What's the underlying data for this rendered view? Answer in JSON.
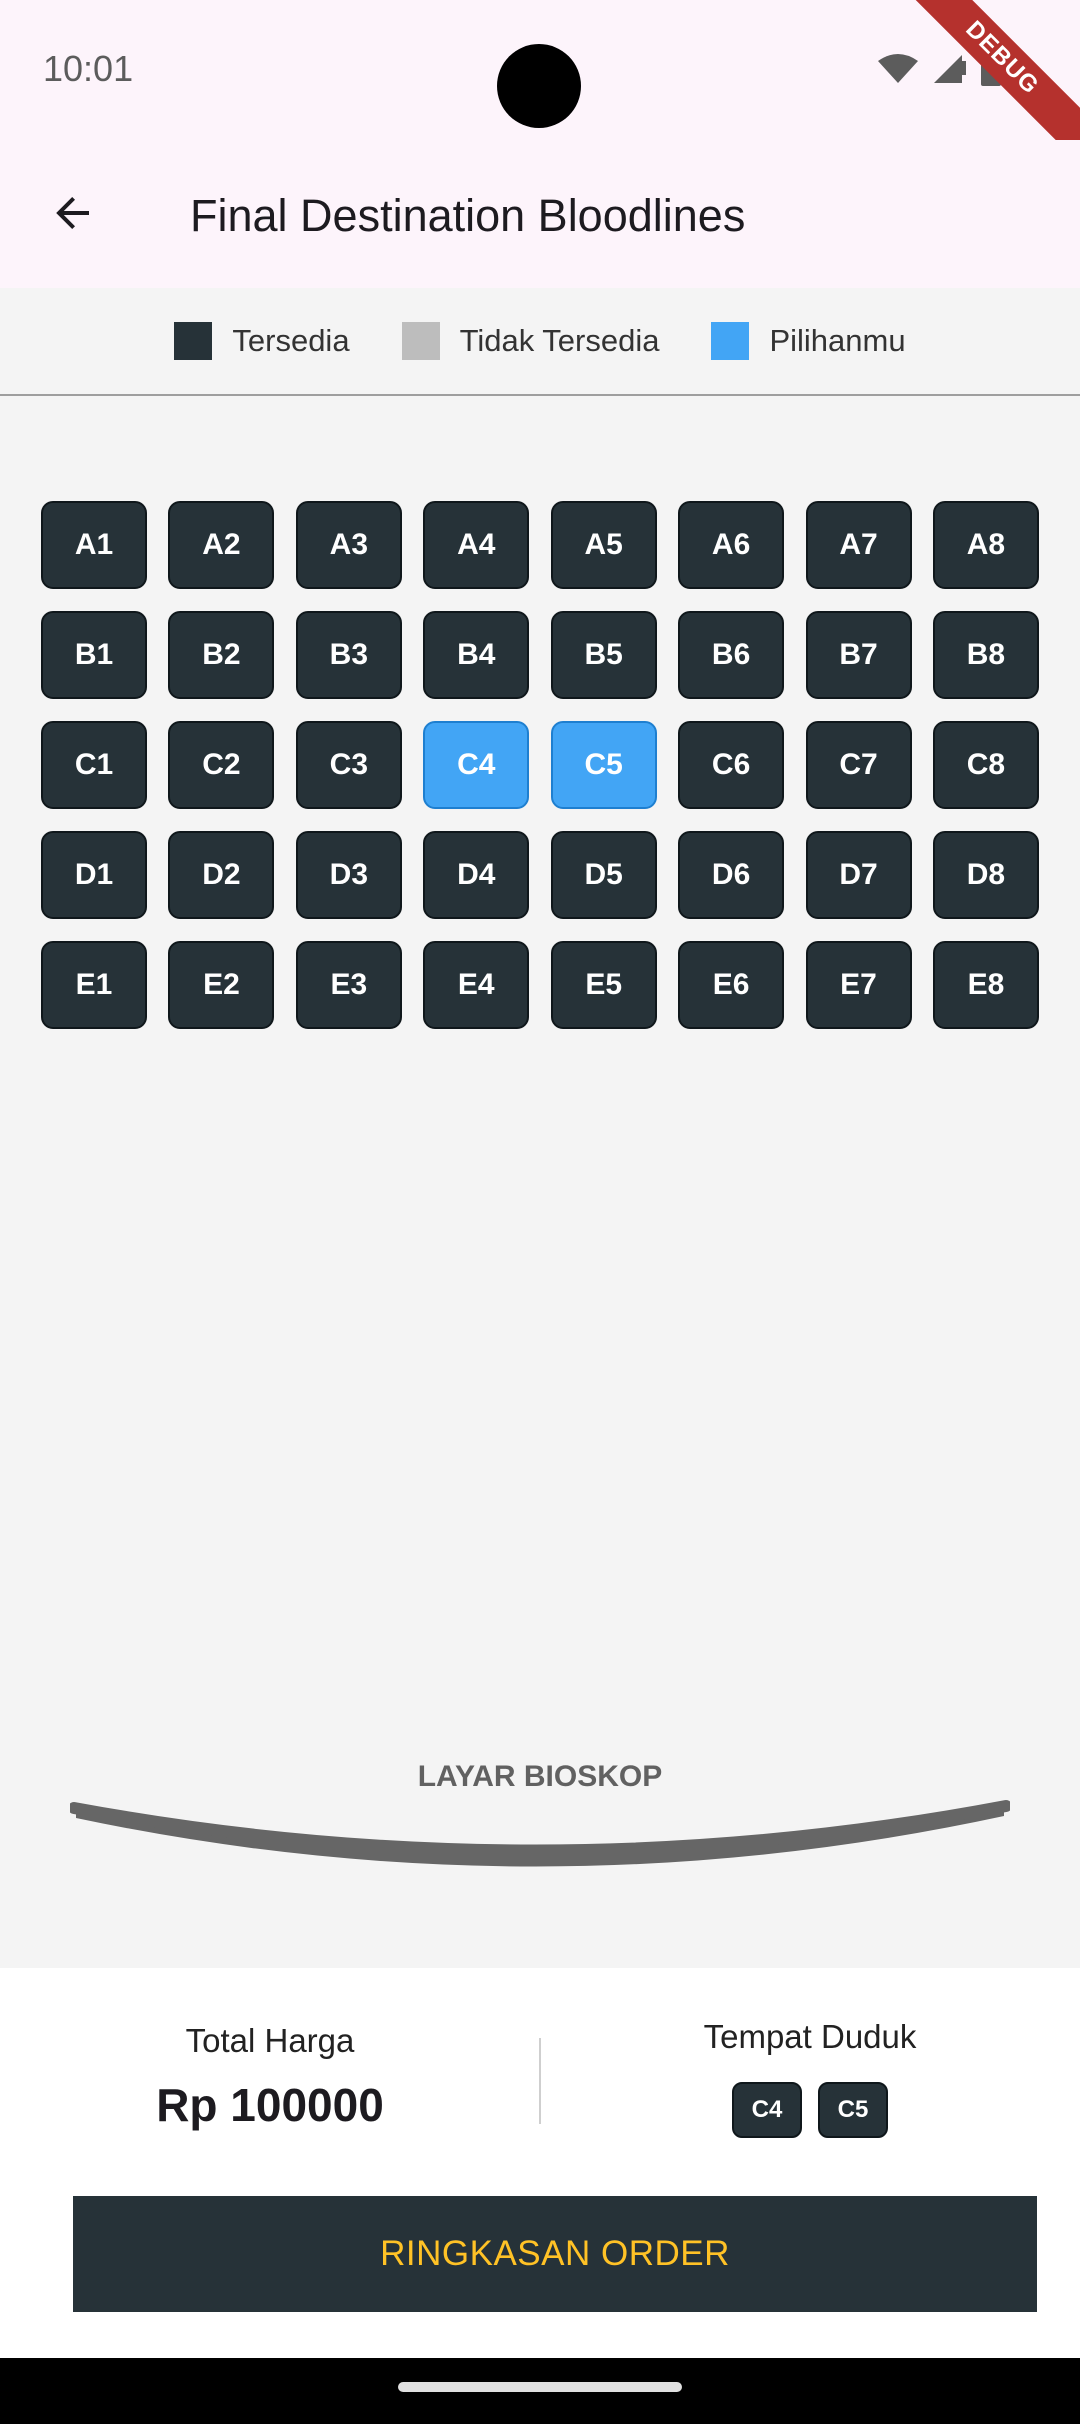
{
  "status_bar": {
    "time": "10:01",
    "debug_label": "DEBUG"
  },
  "app_bar": {
    "title": "Final Destination Bloodlines"
  },
  "legend": [
    {
      "label": "Tersedia",
      "color": "#263238"
    },
    {
      "label": "Tidak Tersedia",
      "color": "#bdbdbd"
    },
    {
      "label": "Pilihanmu",
      "color": "#42a5f5"
    }
  ],
  "seat_rows": [
    {
      "row": "A",
      "seats": [
        {
          "label": "A1",
          "state": "available"
        },
        {
          "label": "A2",
          "state": "available"
        },
        {
          "label": "A3",
          "state": "available"
        },
        {
          "label": "A4",
          "state": "available"
        },
        {
          "label": "A5",
          "state": "available"
        },
        {
          "label": "A6",
          "state": "available"
        },
        {
          "label": "A7",
          "state": "available"
        },
        {
          "label": "A8",
          "state": "available"
        }
      ]
    },
    {
      "row": "B",
      "seats": [
        {
          "label": "B1",
          "state": "available"
        },
        {
          "label": "B2",
          "state": "available"
        },
        {
          "label": "B3",
          "state": "available"
        },
        {
          "label": "B4",
          "state": "available"
        },
        {
          "label": "B5",
          "state": "available"
        },
        {
          "label": "B6",
          "state": "available"
        },
        {
          "label": "B7",
          "state": "available"
        },
        {
          "label": "B8",
          "state": "available"
        }
      ]
    },
    {
      "row": "C",
      "seats": [
        {
          "label": "C1",
          "state": "available"
        },
        {
          "label": "C2",
          "state": "available"
        },
        {
          "label": "C3",
          "state": "available"
        },
        {
          "label": "C4",
          "state": "selected"
        },
        {
          "label": "C5",
          "state": "selected"
        },
        {
          "label": "C6",
          "state": "available"
        },
        {
          "label": "C7",
          "state": "available"
        },
        {
          "label": "C8",
          "state": "available"
        }
      ]
    },
    {
      "row": "D",
      "seats": [
        {
          "label": "D1",
          "state": "available"
        },
        {
          "label": "D2",
          "state": "available"
        },
        {
          "label": "D3",
          "state": "available"
        },
        {
          "label": "D4",
          "state": "available"
        },
        {
          "label": "D5",
          "state": "available"
        },
        {
          "label": "D6",
          "state": "available"
        },
        {
          "label": "D7",
          "state": "available"
        },
        {
          "label": "D8",
          "state": "available"
        }
      ]
    },
    {
      "row": "E",
      "seats": [
        {
          "label": "E1",
          "state": "available"
        },
        {
          "label": "E2",
          "state": "available"
        },
        {
          "label": "E3",
          "state": "available"
        },
        {
          "label": "E4",
          "state": "available"
        },
        {
          "label": "E5",
          "state": "available"
        },
        {
          "label": "E6",
          "state": "available"
        },
        {
          "label": "E7",
          "state": "available"
        },
        {
          "label": "E8",
          "state": "available"
        }
      ]
    }
  ],
  "screen": {
    "label": "LAYAR BIOSKOP"
  },
  "summary": {
    "total_label": "Total Harga",
    "total_value": "Rp 100000",
    "seats_label": "Tempat Duduk",
    "selected_seats": [
      "C4",
      "C5"
    ]
  },
  "order_button": {
    "label": "RINGKASAN ORDER",
    "text_color": "#ffc226",
    "bg_color": "#263238"
  }
}
